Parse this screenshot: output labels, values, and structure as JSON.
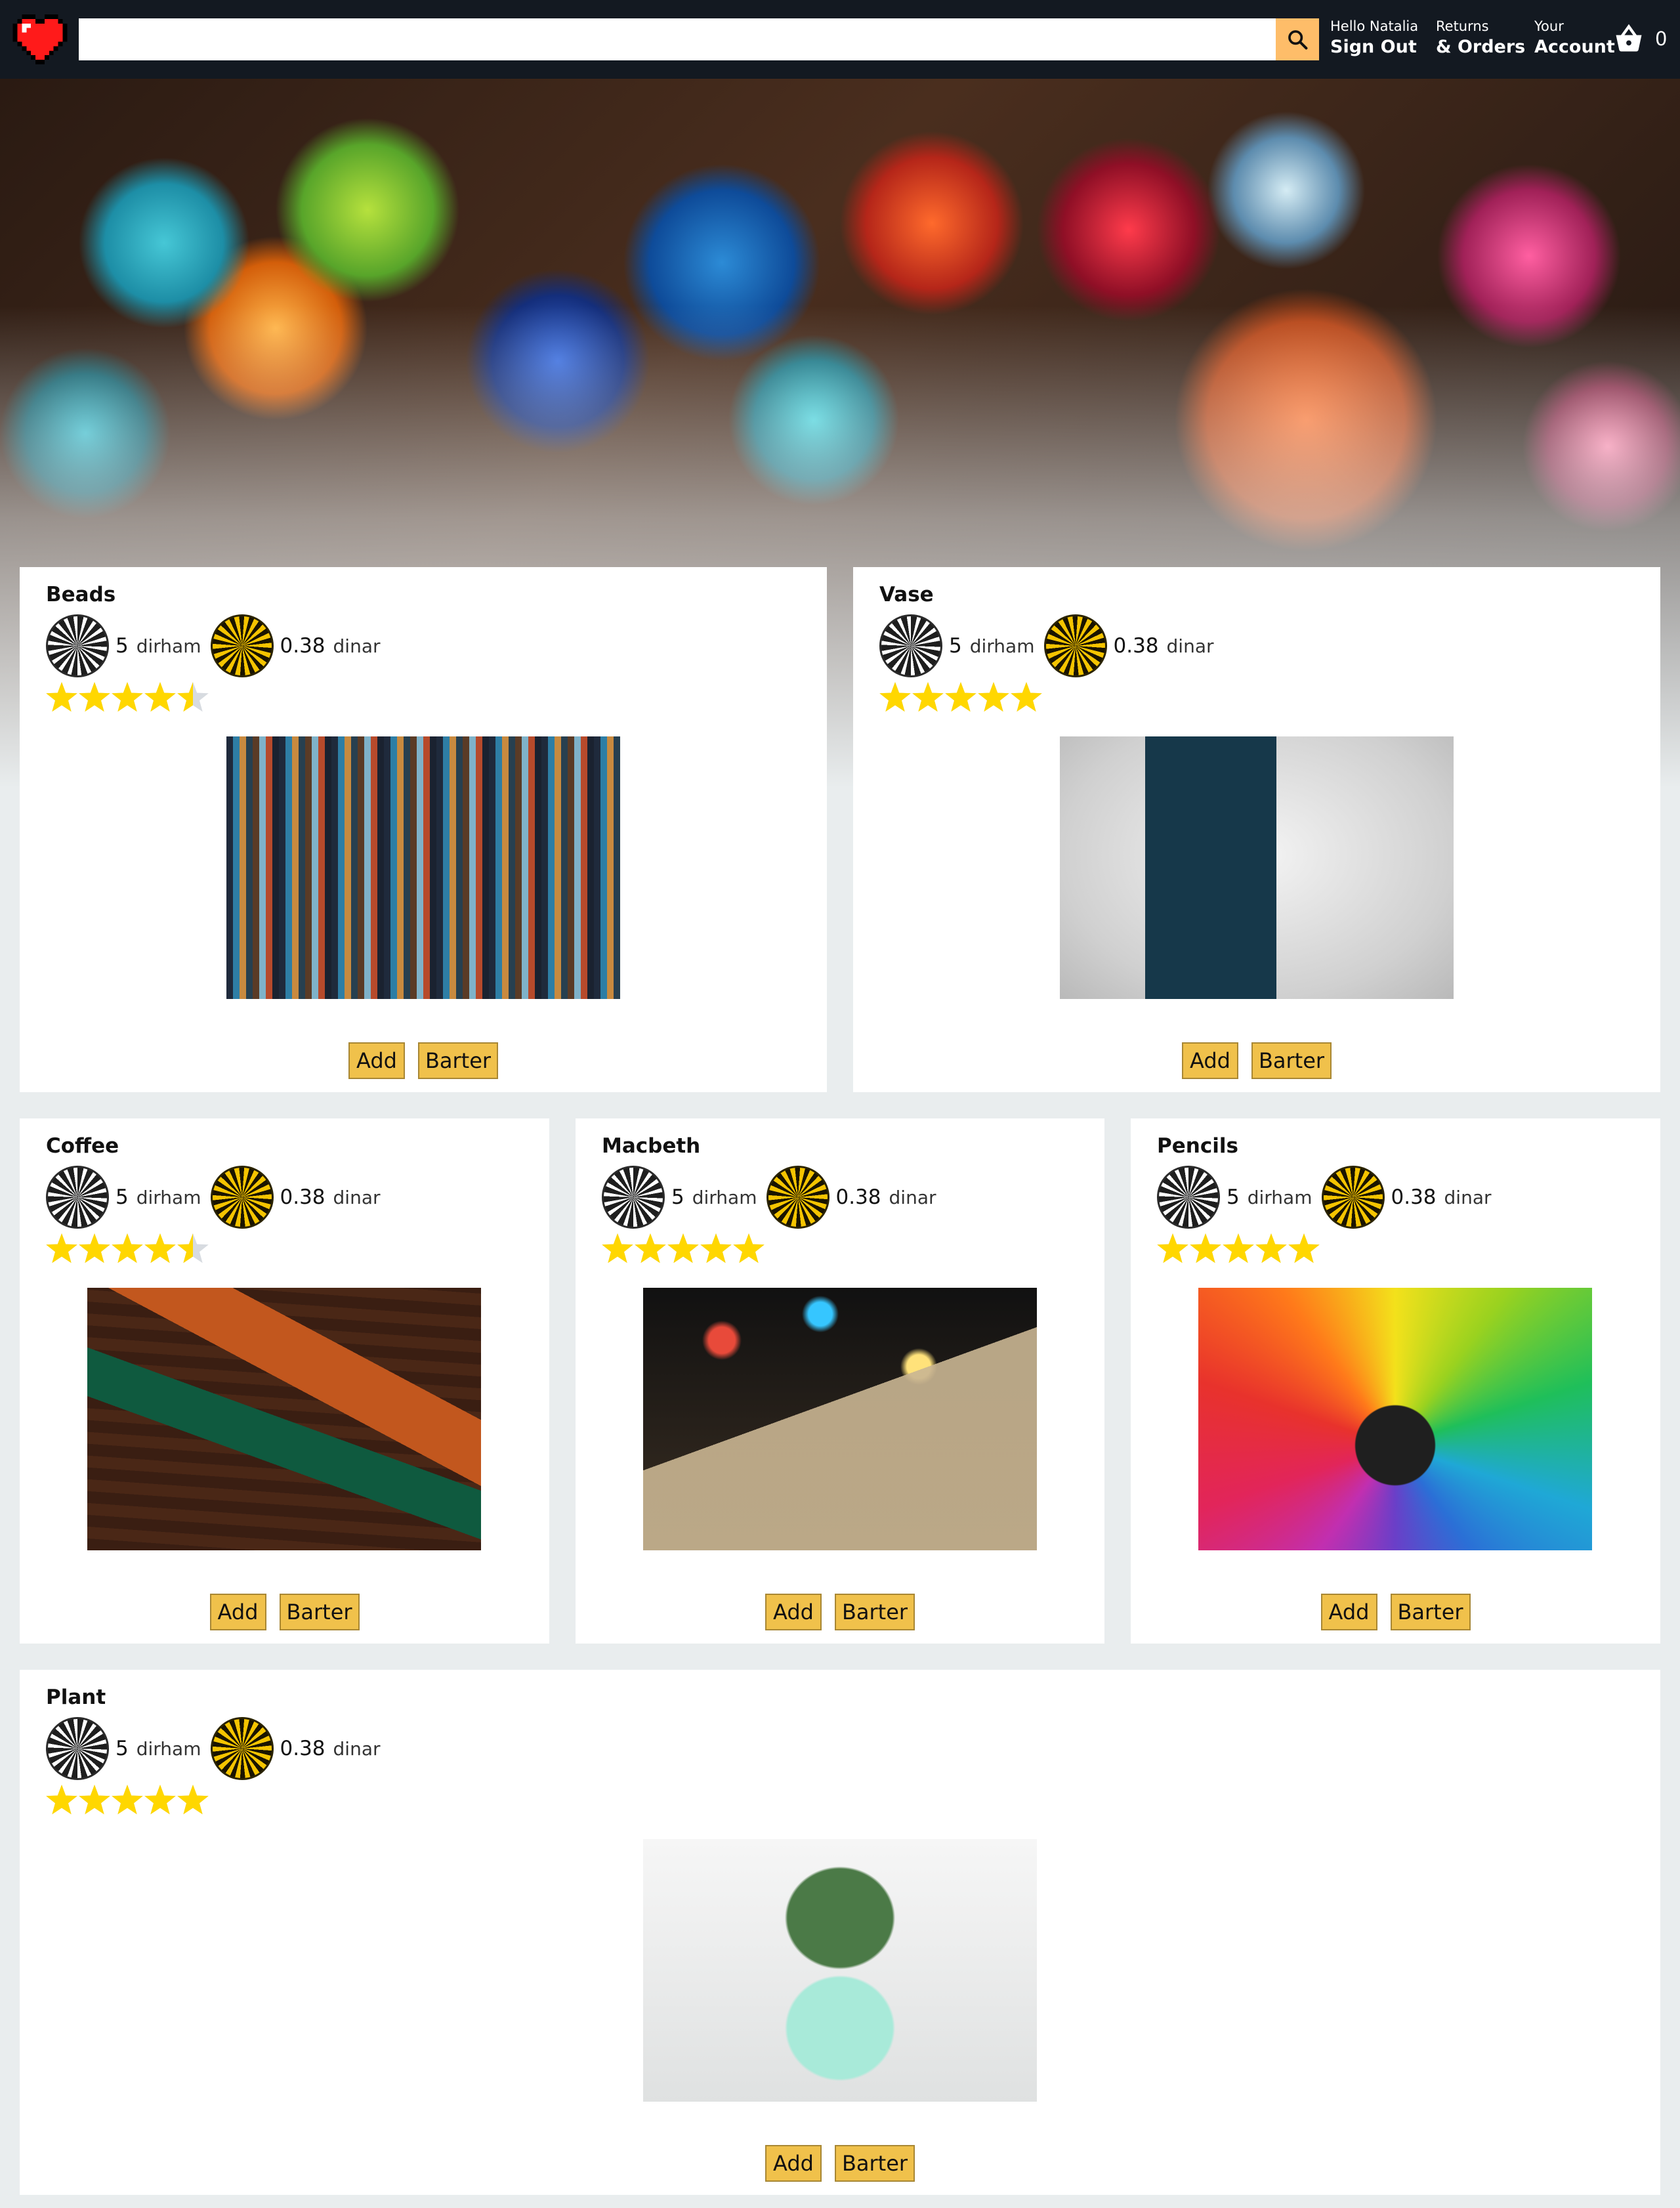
{
  "header": {
    "logo": "heart-logo",
    "search": {
      "value": "",
      "placeholder": ""
    },
    "user_greeting": "Hello Natalia",
    "sign_out": "Sign Out",
    "returns_line1": "Returns",
    "returns_line2": "& Orders",
    "account_line1": "Your",
    "account_line2": "Account",
    "basket_count": "0",
    "colors": {
      "bar": "#131921",
      "search_button": "#febd69"
    }
  },
  "hero": {
    "image": "hanging-mosaic-lanterns"
  },
  "currency": {
    "dirham_icon": "dirham-coin-icon",
    "dinar_icon": "dinar-coin-icon"
  },
  "buttons": {
    "add": "Add",
    "barter": "Barter",
    "color": "#f0c14b"
  },
  "products": [
    {
      "title": "Beads",
      "dirham_amount": "5",
      "dirham_label": "dirham",
      "dinar_amount": "0.38",
      "dinar_label": "dinar",
      "rating": 4.5,
      "image": "beads-photo"
    },
    {
      "title": "Vase",
      "dirham_amount": "5",
      "dirham_label": "dirham",
      "dinar_amount": "0.38",
      "dinar_label": "dinar",
      "rating": 5,
      "image": "vase-photo"
    },
    {
      "title": "Coffee",
      "dirham_amount": "5",
      "dirham_label": "dirham",
      "dinar_amount": "0.38",
      "dinar_label": "dinar",
      "rating": 4.5,
      "image": "coffee-photo"
    },
    {
      "title": "Macbeth",
      "dirham_amount": "5",
      "dirham_label": "dirham",
      "dinar_amount": "0.38",
      "dinar_label": "dinar",
      "rating": 5,
      "image": "macbeth-book-photo"
    },
    {
      "title": "Pencils",
      "dirham_amount": "5",
      "dirham_label": "dirham",
      "dinar_amount": "0.38",
      "dinar_label": "dinar",
      "rating": 5,
      "image": "colored-pencils-photo"
    },
    {
      "title": "Plant",
      "dirham_amount": "5",
      "dirham_label": "dirham",
      "dinar_amount": "0.38",
      "dinar_label": "dinar",
      "rating": 5,
      "image": "potted-succulent-photo"
    }
  ],
  "star_color": "#ffd700"
}
